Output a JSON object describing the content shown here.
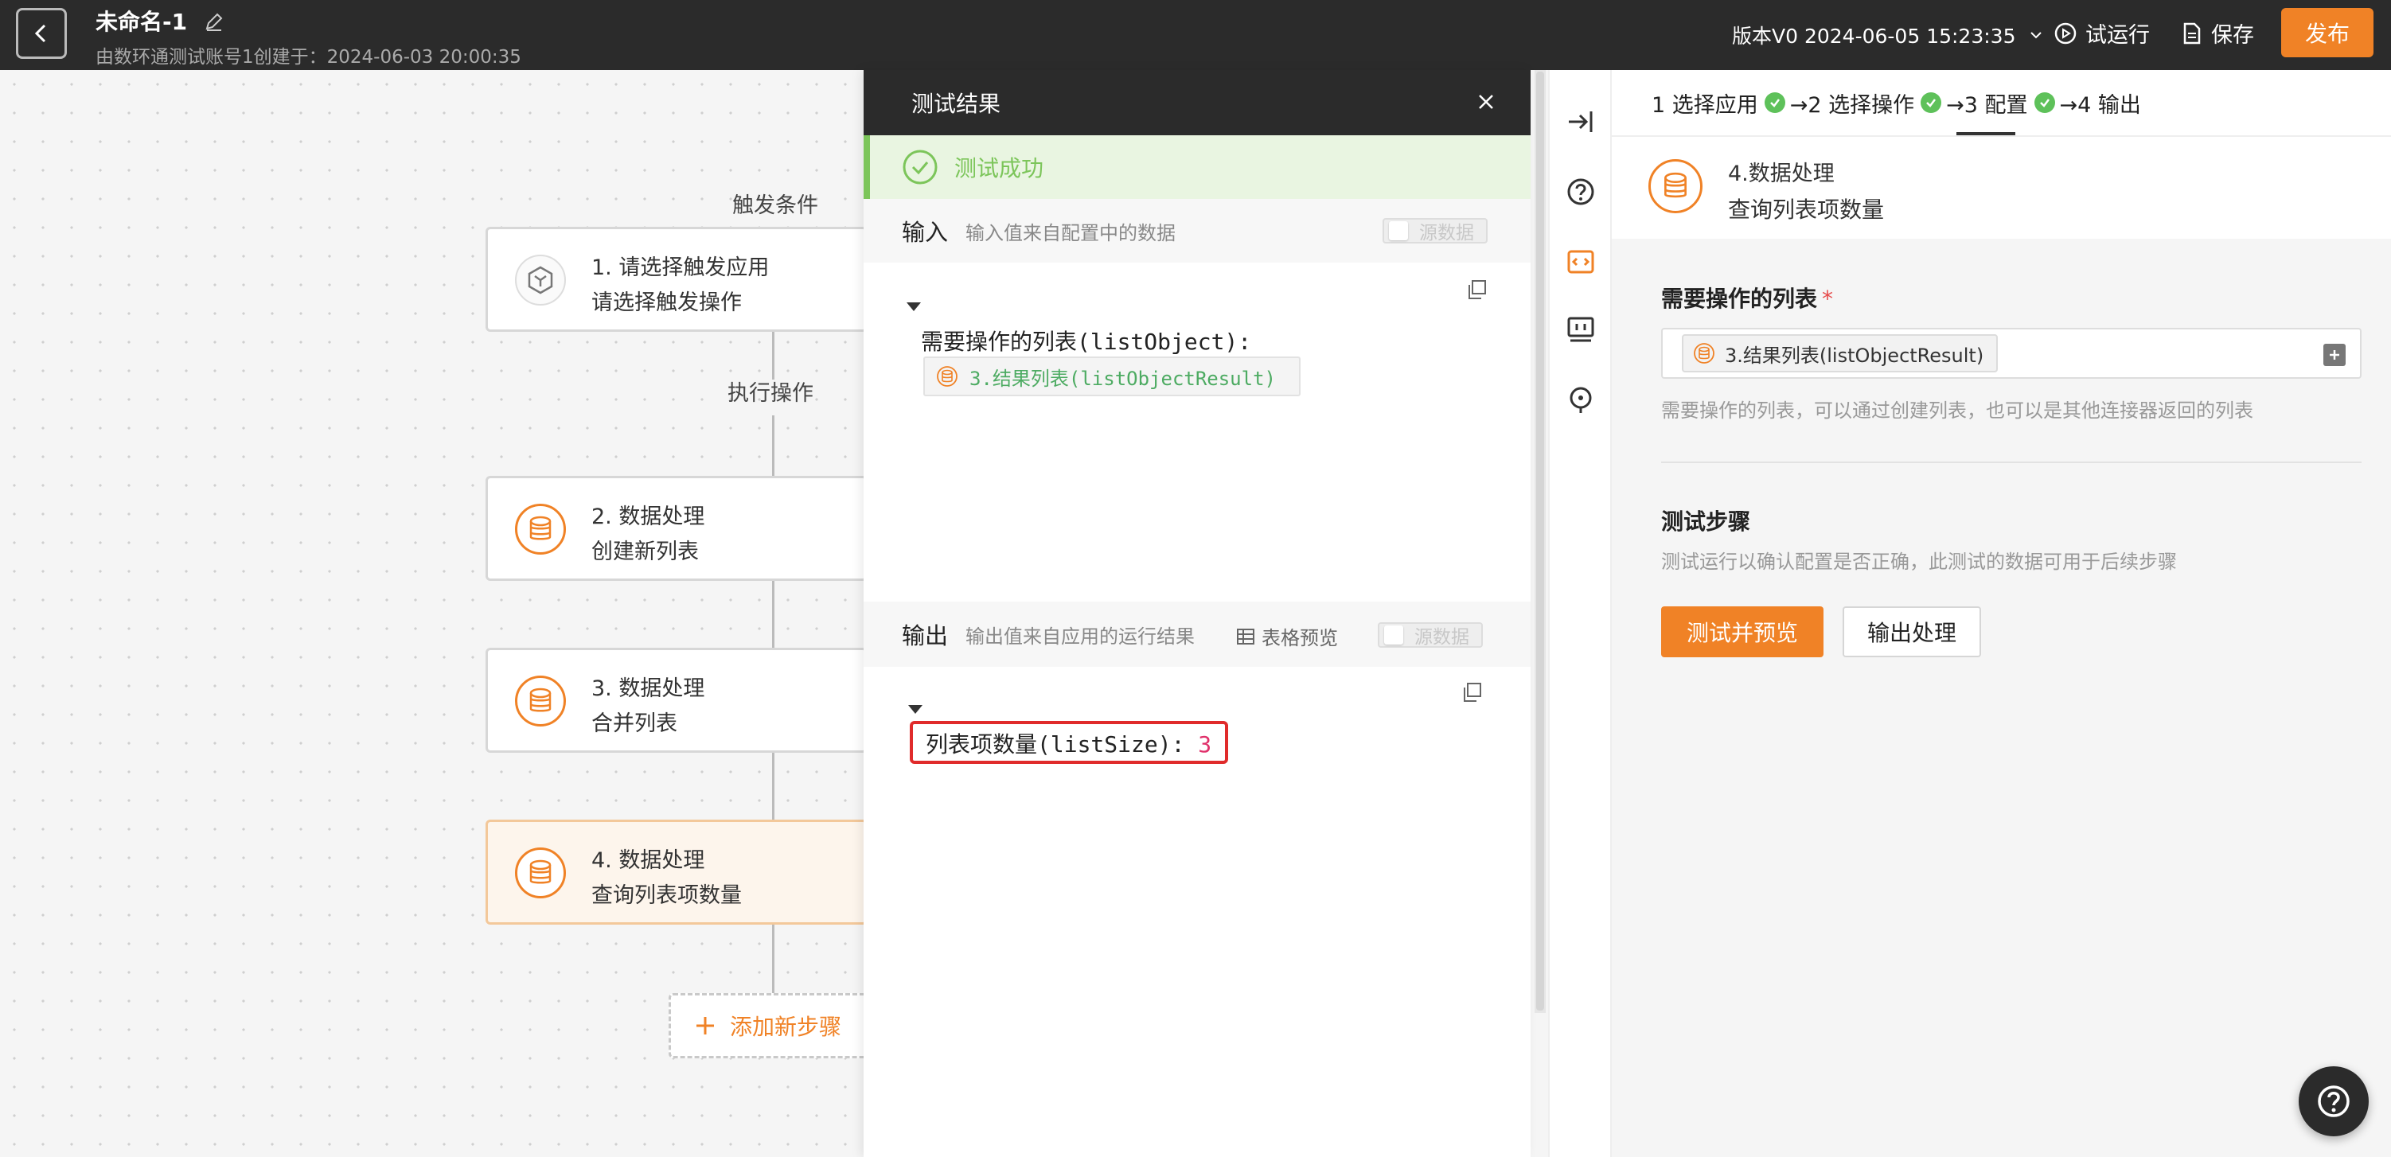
{
  "topbar": {
    "title": "未命名-1",
    "subtitle": "由数环通测试账号1创建于：2024-06-03 20:00:35",
    "version": "版本V0 2024-06-05 15:23:35",
    "trial_run": "试运行",
    "save": "保存",
    "publish": "发布"
  },
  "canvas": {
    "trigger_label": "触发条件",
    "action_label": "执行操作",
    "nodes": [
      {
        "line1": "1. 请选择触发应用",
        "line2": "请选择触发操作"
      },
      {
        "line1": "2. 数据处理",
        "line2": "创建新列表"
      },
      {
        "line1": "3. 数据处理",
        "line2": "合并列表"
      },
      {
        "line1": "4. 数据处理",
        "line2": "查询列表项数量"
      }
    ],
    "add_step": "添加新步骤"
  },
  "results": {
    "title": "测试结果",
    "success": "测试成功",
    "input": {
      "title": "输入",
      "desc": "输入值来自配置中的数据",
      "raw_toggle": "源数据",
      "field_key": "需要操作的列表(listObject):",
      "field_ref": "3.结果列表(listObjectResult)"
    },
    "output": {
      "title": "输出",
      "desc": "输出值来自应用的运行结果",
      "table_preview": "表格预览",
      "raw_toggle": "源数据",
      "field_key": "列表项数量(listSize):",
      "field_value": "3"
    }
  },
  "config": {
    "steps": [
      {
        "label": "1 选择应用"
      },
      {
        "label": "→2 选择操作"
      },
      {
        "label": "→3 配置"
      },
      {
        "label": "→4 输出"
      }
    ],
    "header": {
      "line1": "4.数据处理",
      "line2": "查询列表项数量"
    },
    "list_field": {
      "label": "需要操作的列表",
      "required": "*",
      "chip": "3.结果列表(listObjectResult)",
      "hint": "需要操作的列表，可以通过创建列表，也可以是其他连接器返回的列表"
    },
    "test_step": {
      "label": "测试步骤",
      "hint": "测试运行以确认配置是否正确，此测试的数据可用于后续步骤",
      "test_button": "测试并预览",
      "output_button": "输出处理"
    }
  },
  "colors": {
    "accent": "#f08226",
    "success": "#5ec15a",
    "dark": "#2b2b2b"
  }
}
